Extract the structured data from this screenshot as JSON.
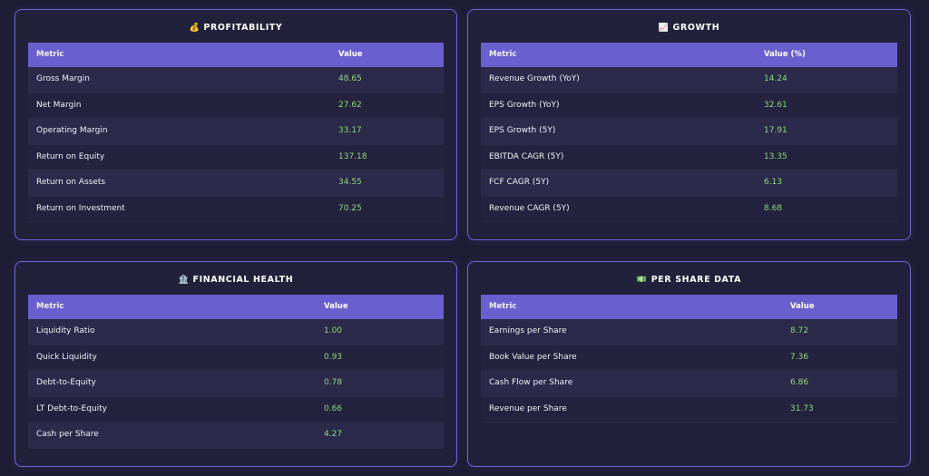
{
  "profitability": {
    "icon": "💰",
    "title": "PROFITABILITY",
    "headers": [
      "Metric",
      "Value"
    ],
    "rows": [
      [
        "Gross Margin",
        "48.65"
      ],
      [
        "Net Margin",
        "27.62"
      ],
      [
        "Operating Margin",
        "33.17"
      ],
      [
        "Return on Equity",
        "137.18"
      ],
      [
        "Return on Assets",
        "34.55"
      ],
      [
        "Return on Investment",
        "70.25"
      ]
    ]
  },
  "growth": {
    "icon": "📈",
    "title": "GROWTH",
    "headers": [
      "Metric",
      "Value (%)"
    ],
    "rows": [
      [
        "Revenue Growth (YoY)",
        "14.24"
      ],
      [
        "EPS Growth (YoY)",
        "32.61"
      ],
      [
        "EPS Growth (5Y)",
        "17.91"
      ],
      [
        "EBITDA CAGR (5Y)",
        "13.35"
      ],
      [
        "FCF CAGR (5Y)",
        "6.13"
      ],
      [
        "Revenue CAGR (5Y)",
        "8.68"
      ]
    ]
  },
  "financial_health": {
    "icon": "🏦",
    "title": "FINANCIAL HEALTH",
    "headers": [
      "Metric",
      "Value"
    ],
    "rows": [
      [
        "Liquidity Ratio",
        "1.00"
      ],
      [
        "Quick Liquidity",
        "0.93"
      ],
      [
        "Debt-to-Equity",
        "0.78"
      ],
      [
        "LT Debt-to-Equity",
        "0.66"
      ],
      [
        "Cash per Share",
        "4.27"
      ]
    ]
  },
  "per_share": {
    "icon": "💵",
    "title": "PER SHARE DATA",
    "headers": [
      "Metric",
      "Value"
    ],
    "rows": [
      [
        "Earnings per Share",
        "8.72"
      ],
      [
        "Book Value per Share",
        "7.36"
      ],
      [
        "Cash Flow per Share",
        "6.86"
      ],
      [
        "Revenue per Share",
        "31.73"
      ]
    ]
  },
  "colors": {
    "header_bg": "#6a5fcf",
    "value_text": "#8fd67a",
    "border": "#6d66d6",
    "background": "#1e1d35"
  }
}
